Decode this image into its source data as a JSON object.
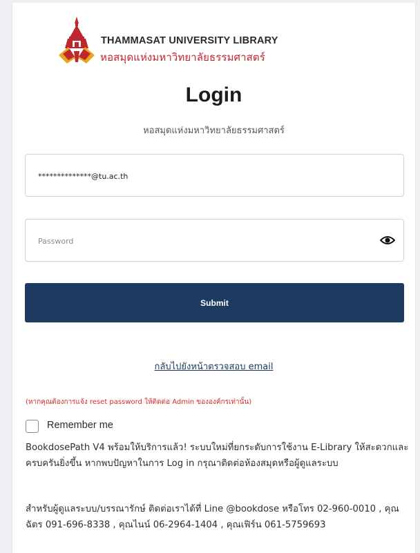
{
  "brand": {
    "name_en": "THAMMASAT UNIVERSITY LIBRARY",
    "name_th": "หอสมุดแห่งมหาวิทยาลัยธรรมศาสตร์",
    "logo_icon": "thammasat-library-logo",
    "accent": "#c0262d",
    "logo_gold": "#e7a51c"
  },
  "login": {
    "title": "Login",
    "subtitle": "หอสมุดแห่งมหาวิทยาลัยธรรมศาสตร์",
    "email_value": "**************@tu.ac.th",
    "password_placeholder": "Password",
    "eye_icon": "eye-icon",
    "submit_label": "Submit",
    "submit_color": "#1d3a60",
    "back_link": "กลับไปยังหน้าตรวจสอบ email",
    "reset_notice": "(หากคุณต้องการแจ้ง reset password ให้ติดต่อ Admin ขององค์กรเท่านั้น)",
    "remember_label": "Remember me",
    "remember_checked": false
  },
  "info": {
    "para1": "BookdosePath V4 พร้อมให้บริการแล้ว! ระบบใหม่ที่ยกระดับการใช้งาน E-Library ให้สะดวกและครบครันยิ่งขึ้น หากพบปัญหาในการ Log in กรุณาติดต่อห้องสมุดหรือผู้ดูแลระบบ",
    "para2": "สำหรับผู้ดูแลระบบ/บรรณารักษ์ ติดต่อเราได้ที่ Line @bookdose หรือโทร 02-960-0010 , คุณฉัตร 091-696-8338 , คุณไนน์ 06-2964-1404 , คุณเฟิร์น 061-5759693"
  }
}
